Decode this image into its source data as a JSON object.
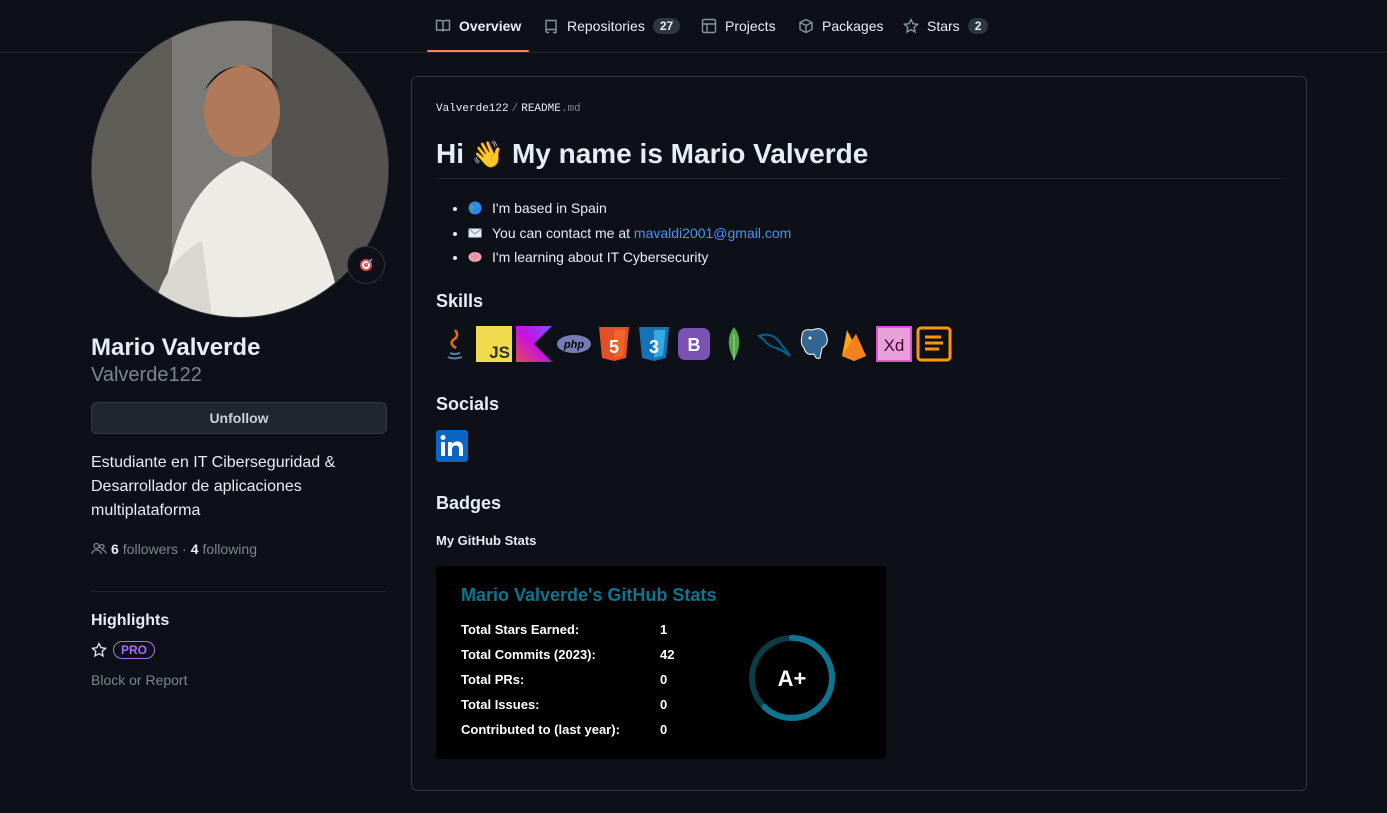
{
  "nav": {
    "tabs": [
      {
        "label": "Overview",
        "icon": "book-icon"
      },
      {
        "label": "Repositories",
        "count": "27",
        "icon": "repo-icon"
      },
      {
        "label": "Projects",
        "icon": "table-icon"
      },
      {
        "label": "Packages",
        "icon": "package-icon"
      },
      {
        "label": "Stars",
        "count": "2",
        "icon": "star-icon"
      }
    ]
  },
  "profile": {
    "full_name": "Mario Valverde",
    "username": "Valverde122",
    "unfollow_label": "Unfollow",
    "bio": "Estudiante en IT Ciberseguridad & Desarrollador de aplicaciones multiplataforma",
    "followers_count": "6",
    "followers_label": "followers",
    "following_count": "4",
    "following_label": "following",
    "highlights_title": "Highlights",
    "pro_badge": "PRO",
    "block_label": "Block or Report"
  },
  "readme": {
    "breadcrumb_user": "Valverde122",
    "breadcrumb_file": "README",
    "breadcrumb_ext": ".md",
    "heading_pre": "Hi",
    "heading_post": "My name is Mario Valverde",
    "facts": [
      {
        "text": "I'm based in Spain",
        "icon": "globe-icon"
      },
      {
        "text": "You can contact me at ",
        "link": "mavaldi2001@gmail.com",
        "icon": "envelope-icon"
      },
      {
        "text": "I'm learning about IT Cybersecurity",
        "icon": "brain-icon"
      }
    ],
    "skills_title": "Skills",
    "skills": [
      "java",
      "javascript",
      "kotlin",
      "php",
      "html5",
      "css3",
      "bootstrap",
      "mongodb",
      "mysql",
      "postgresql",
      "firebase",
      "adobe-xd",
      "sublime"
    ],
    "socials_title": "Socials",
    "social_icon": "linkedin-icon",
    "badges_title": "Badges",
    "stats_label": "My GitHub Stats"
  },
  "stats_card": {
    "title": "Mario Valverde's GitHub Stats",
    "rows": [
      {
        "label": "Total Stars Earned:",
        "value": "1"
      },
      {
        "label": "Total Commits (2023):",
        "value": "42"
      },
      {
        "label": "Total PRs:",
        "value": "0"
      },
      {
        "label": "Total Issues:",
        "value": "0"
      },
      {
        "label": "Contributed to (last year):",
        "value": "0"
      }
    ],
    "rank": "A+",
    "rank_progress_fraction": 0.62,
    "ring_color": "#0e7490"
  }
}
